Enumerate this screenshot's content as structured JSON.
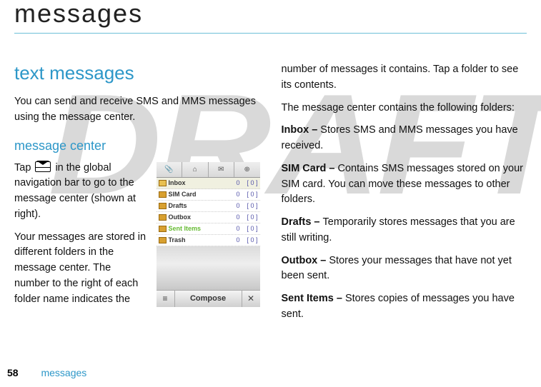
{
  "watermark": "DRAFT",
  "title": "messages",
  "left": {
    "heading": "text messages",
    "intro": "You can send and receive SMS and MMS messages using the message center.",
    "subheading": "message center",
    "para1_before": "Tap ",
    "para1_after": " in the global navigation bar to go to the message center (shown at right).",
    "para2": "Your messages are stored in different folders in the message center. The number to the right of each folder name indicates the"
  },
  "phone": {
    "folders": [
      {
        "name": "Inbox",
        "count": "0",
        "unread": "[ 0 ]"
      },
      {
        "name": "SIM Card",
        "count": "0",
        "unread": "[ 0 ]"
      },
      {
        "name": "Drafts",
        "count": "0",
        "unread": "[ 0 ]"
      },
      {
        "name": "Outbox",
        "count": "0",
        "unread": "[ 0 ]"
      },
      {
        "name": "Sent Items",
        "count": "0",
        "unread": "[ 0 ]"
      },
      {
        "name": "Trash",
        "count": "0",
        "unread": "[ 0 ]"
      }
    ],
    "compose": "Compose"
  },
  "right": {
    "p1": "number of messages it contains. Tap a folder to see its contents.",
    "p2": "The message center contains the following folders:",
    "inbox_label": "Inbox – ",
    "inbox_text": "Stores SMS and MMS messages you have received.",
    "sim_label": "SIM Card – ",
    "sim_text": "Contains SMS messages stored on your SIM card. You can move these messages to other folders.",
    "drafts_label": "Drafts – ",
    "drafts_text": "Temporarily stores messages that you are still writing.",
    "outbox_label": "Outbox – ",
    "outbox_text": "Stores your messages that have not yet been sent.",
    "sent_label": "Sent Items – ",
    "sent_text": "Stores copies of messages you have sent."
  },
  "footer": {
    "page": "58",
    "section": "messages"
  }
}
